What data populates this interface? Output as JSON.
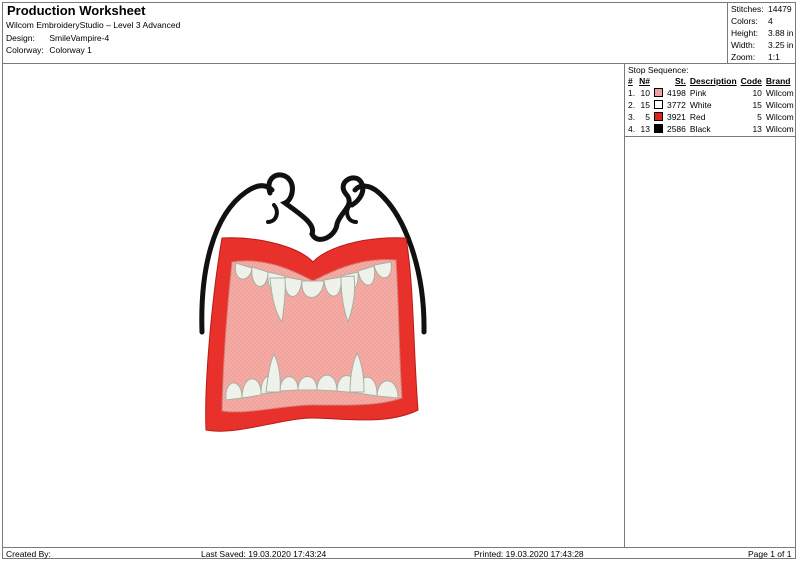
{
  "header": {
    "title": "Production Worksheet",
    "software": "Wilcom EmbroideryStudio – Level 3 Advanced",
    "design_label": "Design:",
    "design_value": "SmileVampire-4",
    "colorway_label": "Colorway:",
    "colorway_value": "Colorway 1"
  },
  "stats": [
    {
      "label": "Stitches:",
      "value": "14479"
    },
    {
      "label": "Colors:",
      "value": "4"
    },
    {
      "label": "Height:",
      "value": "3.88 in"
    },
    {
      "label": "Width:",
      "value": "3.25 in"
    },
    {
      "label": "Zoom:",
      "value": "1:1"
    }
  ],
  "stop_sequence": {
    "title": "Stop Sequence:",
    "headers": [
      "#",
      "N#",
      "St.",
      "Description",
      "Code",
      "Brand"
    ],
    "rows": [
      {
        "num": "1.",
        "n": "10",
        "swatch": "#f0a0a0",
        "st": "4198",
        "desc": "Pink",
        "code": "10",
        "brand": "Wilcom"
      },
      {
        "num": "2.",
        "n": "15",
        "swatch": "#ffffff",
        "st": "3772",
        "desc": "White",
        "code": "15",
        "brand": "Wilcom"
      },
      {
        "num": "3.",
        "n": "5",
        "swatch": "#e02020",
        "st": "3921",
        "desc": "Red",
        "code": "5",
        "brand": "Wilcom"
      },
      {
        "num": "4.",
        "n": "13",
        "swatch": "#000000",
        "st": "2586",
        "desc": "Black",
        "code": "13",
        "brand": "Wilcom"
      }
    ]
  },
  "footer": {
    "created_by": "Created By:",
    "last_saved": "Last Saved: 19.03.2020 17:43:24",
    "printed": "Printed: 19.03.2020 17:43:28",
    "page": "Page 1 of 1"
  },
  "colors": {
    "lip_red": "#e8312b",
    "mouth_pink": "#f2a39c",
    "teeth_white": "#eef2ea",
    "outline_black": "#111111"
  }
}
